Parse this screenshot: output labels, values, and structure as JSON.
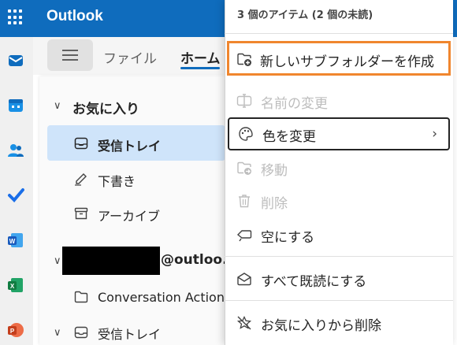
{
  "app": {
    "title": "Outlook"
  },
  "ribbon": {
    "tabs": [
      "ファイル",
      "ホーム"
    ]
  },
  "folder_pane": {
    "favorites_header": "お気に入り",
    "favorites": [
      {
        "label": "受信トレイ",
        "icon": "inbox-icon",
        "selected": true
      },
      {
        "label": "下書き",
        "icon": "draft-icon",
        "selected": false
      },
      {
        "label": "アーカイブ",
        "icon": "archive-icon",
        "selected": false
      }
    ],
    "account_suffix": "@outloo.",
    "account_items": [
      {
        "label": "Conversation Action",
        "icon": "folder-icon"
      },
      {
        "label": "受信トレイ",
        "icon": "inbox-icon"
      }
    ]
  },
  "context_menu": {
    "header": "3 個のアイテム (2 個の未読)",
    "items": [
      {
        "label": "新しいサブフォルダーを作成",
        "icon": "new-folder-icon",
        "enabled": true
      },
      {
        "label": "名前の変更",
        "icon": "rename-icon",
        "enabled": false
      },
      {
        "label": "色を変更",
        "icon": "palette-icon",
        "enabled": true,
        "submenu": true
      },
      {
        "label": "移動",
        "icon": "move-folder-icon",
        "enabled": false
      },
      {
        "label": "削除",
        "icon": "trash-icon",
        "enabled": false
      },
      {
        "label": "空にする",
        "icon": "eraser-icon",
        "enabled": true
      },
      {
        "label": "すべて既読にする",
        "icon": "envelope-open-icon",
        "enabled": true
      },
      {
        "label": "お気に入りから削除",
        "icon": "star-off-icon",
        "enabled": true
      }
    ]
  },
  "colors": {
    "brand": "#0f6cbd",
    "selected": "#cfe4fa",
    "highlight": "#f0862e"
  }
}
